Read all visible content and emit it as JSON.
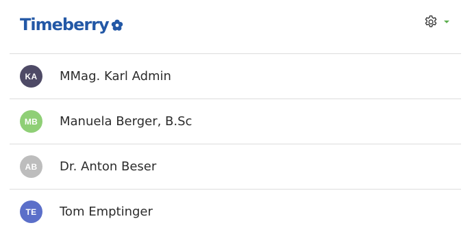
{
  "header": {
    "logo_text": "Timeberry",
    "logo_icon": "flower-icon",
    "settings_icon": "gear-icon",
    "dropdown_icon": "caret-down-icon",
    "brand_color": "#2358a6",
    "caret_color": "#5cae4e"
  },
  "users": [
    {
      "initials": "KA",
      "name": "MMag. Karl Admin",
      "avatar_color": "#4e4a66"
    },
    {
      "initials": "MB",
      "name": "Manuela Berger, B.Sc",
      "avatar_color": "#8fcf76"
    },
    {
      "initials": "AB",
      "name": "Dr. Anton Beser",
      "avatar_color": "#bdbdbd"
    },
    {
      "initials": "TE",
      "name": "Tom Emptinger",
      "avatar_color": "#5b6fc9"
    }
  ]
}
